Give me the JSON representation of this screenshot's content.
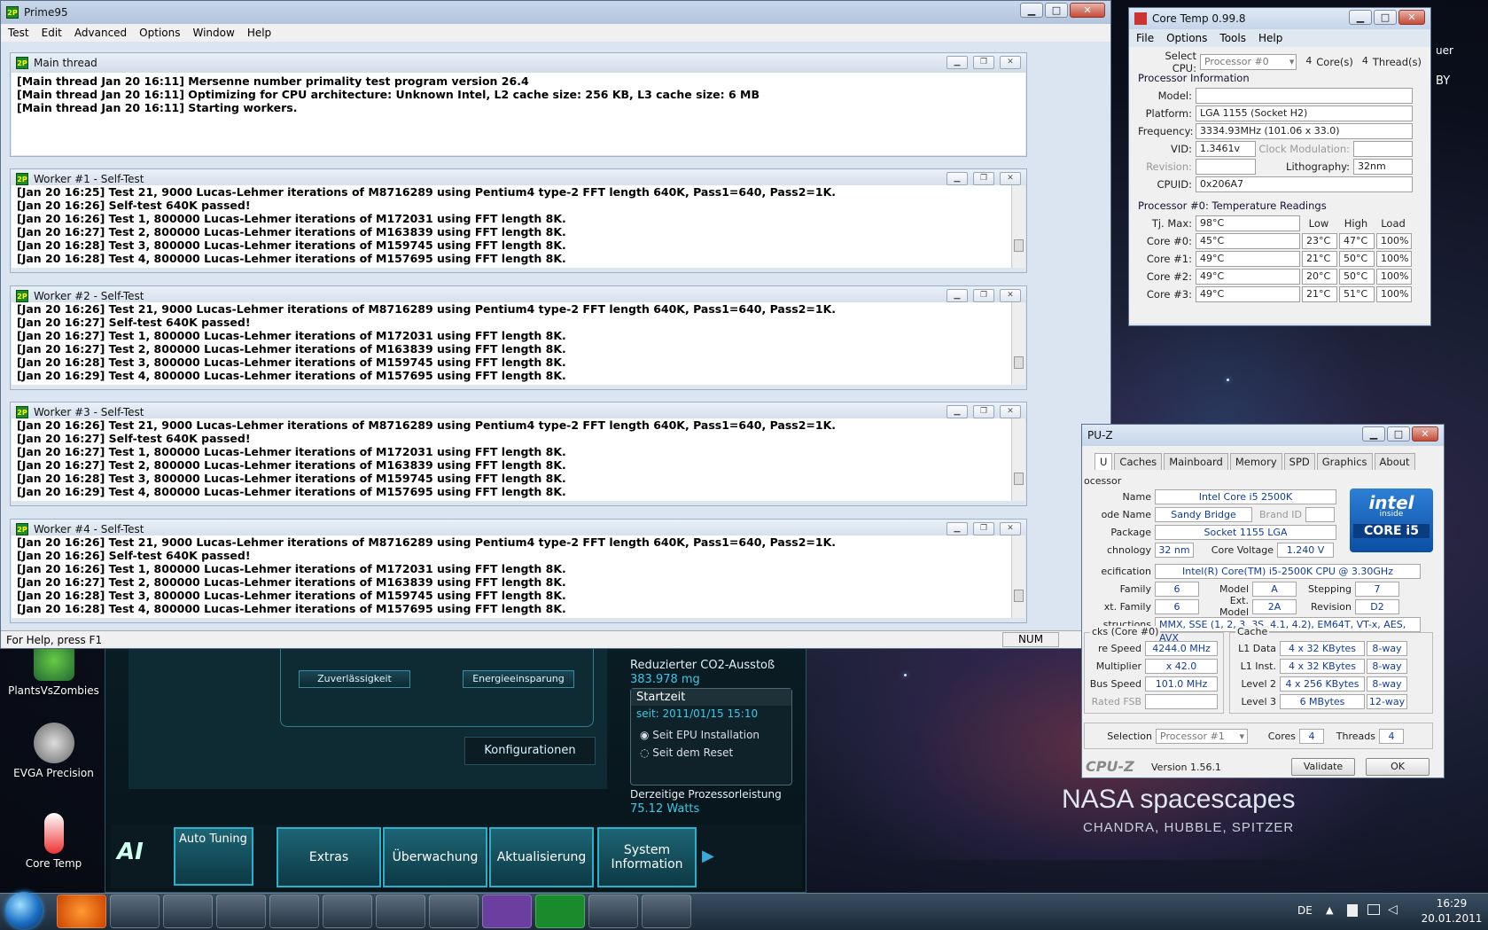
{
  "prime95": {
    "title": "Prime95",
    "menu": [
      "Test",
      "Edit",
      "Advanced",
      "Options",
      "Window",
      "Help"
    ],
    "main_thread": {
      "title": "Main thread",
      "lines": [
        "[Main thread Jan 20 16:11] Mersenne number primality test program version 26.4",
        "[Main thread Jan 20 16:11] Optimizing for CPU architecture: Unknown Intel, L2 cache size: 256 KB, L3 cache size: 6 MB",
        "[Main thread Jan 20 16:11] Starting workers."
      ]
    },
    "workers": [
      {
        "title": "Worker #1 - Self-Test",
        "lines": [
          "[Jan 20 16:25] Test 21, 9000 Lucas-Lehmer iterations of M8716289 using Pentium4 type-2 FFT length 640K, Pass1=640, Pass2=1K.",
          "[Jan 20 16:26] Self-test 640K passed!",
          "[Jan 20 16:26] Test 1, 800000 Lucas-Lehmer iterations of M172031 using FFT length 8K.",
          "[Jan 20 16:27] Test 2, 800000 Lucas-Lehmer iterations of M163839 using FFT length 8K.",
          "[Jan 20 16:28] Test 3, 800000 Lucas-Lehmer iterations of M159745 using FFT length 8K.",
          "[Jan 20 16:28] Test 4, 800000 Lucas-Lehmer iterations of M157695 using FFT length 8K."
        ]
      },
      {
        "title": "Worker #2 - Self-Test",
        "lines": [
          "[Jan 20 16:26] Test 21, 9000 Lucas-Lehmer iterations of M8716289 using Pentium4 type-2 FFT length 640K, Pass1=640, Pass2=1K.",
          "[Jan 20 16:27] Self-test 640K passed!",
          "[Jan 20 16:27] Test 1, 800000 Lucas-Lehmer iterations of M172031 using FFT length 8K.",
          "[Jan 20 16:27] Test 2, 800000 Lucas-Lehmer iterations of M163839 using FFT length 8K.",
          "[Jan 20 16:28] Test 3, 800000 Lucas-Lehmer iterations of M159745 using FFT length 8K.",
          "[Jan 20 16:29] Test 4, 800000 Lucas-Lehmer iterations of M157695 using FFT length 8K."
        ]
      },
      {
        "title": "Worker #3 - Self-Test",
        "lines": [
          "[Jan 20 16:26] Test 21, 9000 Lucas-Lehmer iterations of M8716289 using Pentium4 type-2 FFT length 640K, Pass1=640, Pass2=1K.",
          "[Jan 20 16:27] Self-test 640K passed!",
          "[Jan 20 16:27] Test 1, 800000 Lucas-Lehmer iterations of M172031 using FFT length 8K.",
          "[Jan 20 16:27] Test 2, 800000 Lucas-Lehmer iterations of M163839 using FFT length 8K.",
          "[Jan 20 16:28] Test 3, 800000 Lucas-Lehmer iterations of M159745 using FFT length 8K.",
          "[Jan 20 16:29] Test 4, 800000 Lucas-Lehmer iterations of M157695 using FFT length 8K."
        ]
      },
      {
        "title": "Worker #4 - Self-Test",
        "lines": [
          "[Jan 20 16:26] Test 21, 9000 Lucas-Lehmer iterations of M8716289 using Pentium4 type-2 FFT length 640K, Pass1=640, Pass2=1K.",
          "[Jan 20 16:26] Self-test 640K passed!",
          "[Jan 20 16:26] Test 1, 800000 Lucas-Lehmer iterations of M172031 using FFT length 8K.",
          "[Jan 20 16:27] Test 2, 800000 Lucas-Lehmer iterations of M163839 using FFT length 8K.",
          "[Jan 20 16:28] Test 3, 800000 Lucas-Lehmer iterations of M159745 using FFT length 8K.",
          "[Jan 20 16:28] Test 4, 800000 Lucas-Lehmer iterations of M157695 using FFT length 8K."
        ]
      }
    ],
    "status_text": "For Help, press F1",
    "status_num": "NUM"
  },
  "coretemp": {
    "title": "Core Temp 0.99.8",
    "menu": [
      "File",
      "Options",
      "Tools",
      "Help"
    ],
    "select_cpu_label": "Select CPU:",
    "select_cpu_value": "Processor #0",
    "cores_value": "4",
    "cores_label": "Core(s)",
    "threads_value": "4",
    "threads_label": "Thread(s)",
    "info_header": "Processor Information",
    "model_label": "Model:",
    "model_value": "",
    "platform_label": "Platform:",
    "platform_value": "LGA 1155 (Socket H2)",
    "frequency_label": "Frequency:",
    "frequency_value": "3334.93MHz (101.06 x 33.0)",
    "vid_label": "VID:",
    "vid_value": "1.3461v",
    "clock_mod_label": "Clock Modulation:",
    "revision_label": "Revision:",
    "lithography_label": "Lithography:",
    "lithography_value": "32nm",
    "cpuid_label": "CPUID:",
    "cpuid_value": "0x206A7",
    "temp_header": "Processor #0: Temperature Readings",
    "tjmax_label": "Tj. Max:",
    "tjmax_value": "98°C",
    "col_low": "Low",
    "col_high": "High",
    "col_load": "Load",
    "cores": [
      {
        "label": "Core #0:",
        "temp": "45°C",
        "low": "23°C",
        "high": "47°C",
        "load": "100%"
      },
      {
        "label": "Core #1:",
        "temp": "49°C",
        "low": "21°C",
        "high": "50°C",
        "load": "100%"
      },
      {
        "label": "Core #2:",
        "temp": "49°C",
        "low": "20°C",
        "high": "50°C",
        "load": "100%"
      },
      {
        "label": "Core #3:",
        "temp": "49°C",
        "low": "21°C",
        "high": "51°C",
        "load": "100%"
      }
    ]
  },
  "cpuz": {
    "title": "PU-Z",
    "tabs": [
      "U",
      "Caches",
      "Mainboard",
      "Memory",
      "SPD",
      "Graphics",
      "About"
    ],
    "processor_caption": "ocessor",
    "name_label": "Name",
    "name_value": "Intel Core i5 2500K",
    "codename_label": "ode Name",
    "codename_value": "Sandy Bridge",
    "brandid_label": "Brand ID",
    "package_label": "Package",
    "package_value": "Socket 1155 LGA",
    "technology_label": "chnology",
    "technology_value": "32 nm",
    "corevoltage_label": "Core Voltage",
    "corevoltage_value": "1.240 V",
    "spec_label": "ecification",
    "spec_value": "Intel(R) Core(TM) i5-2500K CPU @ 3.30GHz",
    "family_label": "Family",
    "family_value": "6",
    "model_label": "Model",
    "model_value": "A",
    "stepping_label": "Stepping",
    "stepping_value": "7",
    "extfamily_label": "xt. Family",
    "extfamily_value": "6",
    "extmodel_label": "Ext. Model",
    "extmodel_value": "2A",
    "revision_label": "Revision",
    "revision_value": "D2",
    "instr_label": "structions",
    "instr_value": "MMX, SSE (1, 2, 3, 3S, 4.1, 4.2), EM64T, VT-x, AES, AVX",
    "clocks_caption": "cks (Core #0)",
    "corespeed_label": "re Speed",
    "corespeed_value": "4244.0 MHz",
    "multiplier_label": "Multiplier",
    "multiplier_value": "x 42.0",
    "busspeed_label": "Bus Speed",
    "busspeed_value": "101.0 MHz",
    "ratedfsb_label": "Rated FSB",
    "cache_caption": "Cache",
    "cache": [
      {
        "label": "L1 Data",
        "size": "4 x 32 KBytes",
        "way": "8-way"
      },
      {
        "label": "L1 Inst.",
        "size": "4 x 32 KBytes",
        "way": "8-way"
      },
      {
        "label": "Level 2",
        "size": "4 x 256 KBytes",
        "way": "8-way"
      },
      {
        "label": "Level 3",
        "size": "6 MBytes",
        "way": "12-way"
      }
    ],
    "selection_label": "Selection",
    "selection_value": "Processor #1",
    "cores_label": "Cores",
    "cores_value": "4",
    "threads_label": "Threads",
    "threads_value": "4",
    "brand": "CPU-Z",
    "version": "Version 1.56.1",
    "validate_btn": "Validate",
    "ok_btn": "OK",
    "intel_logo_line1": "intel",
    "intel_logo_line2": "inside",
    "intel_logo_line3": "CORE i5"
  },
  "aisuite": {
    "btn_zuverlaessigkeit": "Zuverlässigkeit",
    "btn_energie": "Energieeinsparung",
    "btn_konfig": "Konfigurationen",
    "co2_label": "Reduzierter CO2-Ausstoß",
    "co2_value": "383.978 mg",
    "startzeit_label": "Startzeit",
    "startzeit_value": "seit: 2011/01/15 15:10",
    "radio1": "Seit EPU Installation",
    "radio2": "Seit dem Reset",
    "power_label": "Derzeitige Prozessorleistung",
    "power_value": "75.12 Watts",
    "tiles": [
      "Auto Tuning",
      "Extras",
      "Überwachung",
      "Aktualisierung",
      "System Information"
    ]
  },
  "desktop": {
    "icons": [
      "PlantsVsZombies",
      "EVGA Precision",
      "Core Temp"
    ],
    "wallpaper_title": "NASA spacescapes",
    "wallpaper_sub": "CHANDRA, HUBBLE, SPITZER",
    "partial_text_1": "uer",
    "partial_text_2": "BY"
  },
  "taskbar": {
    "lang": "DE",
    "time": "16:29",
    "date": "20.01.2011"
  }
}
